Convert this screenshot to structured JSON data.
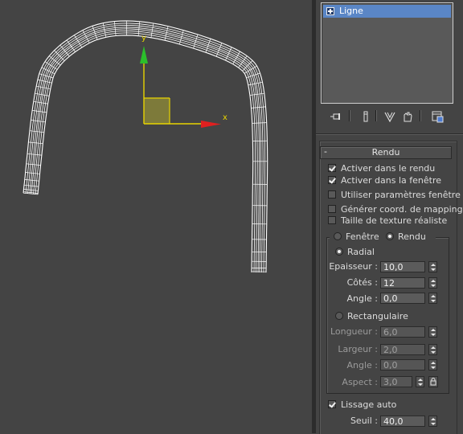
{
  "viewport": {
    "axis_x_label": "x",
    "axis_y_label": "y",
    "axis_x_color": "#e02020",
    "axis_y_color": "#2bbf2b",
    "gizmo_color": "#e8d400",
    "wire_color": "#ffffff"
  },
  "modifier_stack": {
    "items": [
      {
        "label": "Ligne",
        "selected": true
      }
    ],
    "tools": [
      "pin-stack-icon",
      "show-end-result-icon",
      "make-unique-icon",
      "remove-modifier-icon",
      "configure-modifier-sets-icon"
    ]
  },
  "rollout": {
    "toggle": "-",
    "title": "Rendu",
    "checkboxes": [
      {
        "label": "Activer dans le rendu",
        "checked": true
      },
      {
        "label": "Activer dans la fenêtre",
        "checked": true
      },
      {
        "label": "Utiliser paramètres fenêtre",
        "checked": false
      },
      {
        "label": "Générer coord. de mapping",
        "checked": false
      },
      {
        "label": "Taille de texture réaliste",
        "checked": false
      }
    ],
    "mode": {
      "fenetre": "Fenêtre",
      "rendu": "Rendu",
      "selected": "rendu"
    },
    "radial": {
      "label": "Radial",
      "selected": true,
      "epaisseur_label": "Epaisseur :",
      "epaisseur": "10,0",
      "cotes_label": "Côtés :",
      "cotes": "12",
      "angle_label": "Angle :",
      "angle": "0,0"
    },
    "rectangular": {
      "label": "Rectangulaire",
      "selected": false,
      "longueur_label": "Longueur :",
      "longueur": "6,0",
      "largeur_label": "Largeur :",
      "largeur": "2,0",
      "angle_label": "Angle :",
      "angle": "0,0",
      "aspect_label": "Aspect :",
      "aspect": "3,0"
    },
    "lissage_auto": {
      "label": "Lissage auto",
      "checked": true
    },
    "seuil": {
      "label": "Seuil :",
      "value": "40,0"
    }
  }
}
